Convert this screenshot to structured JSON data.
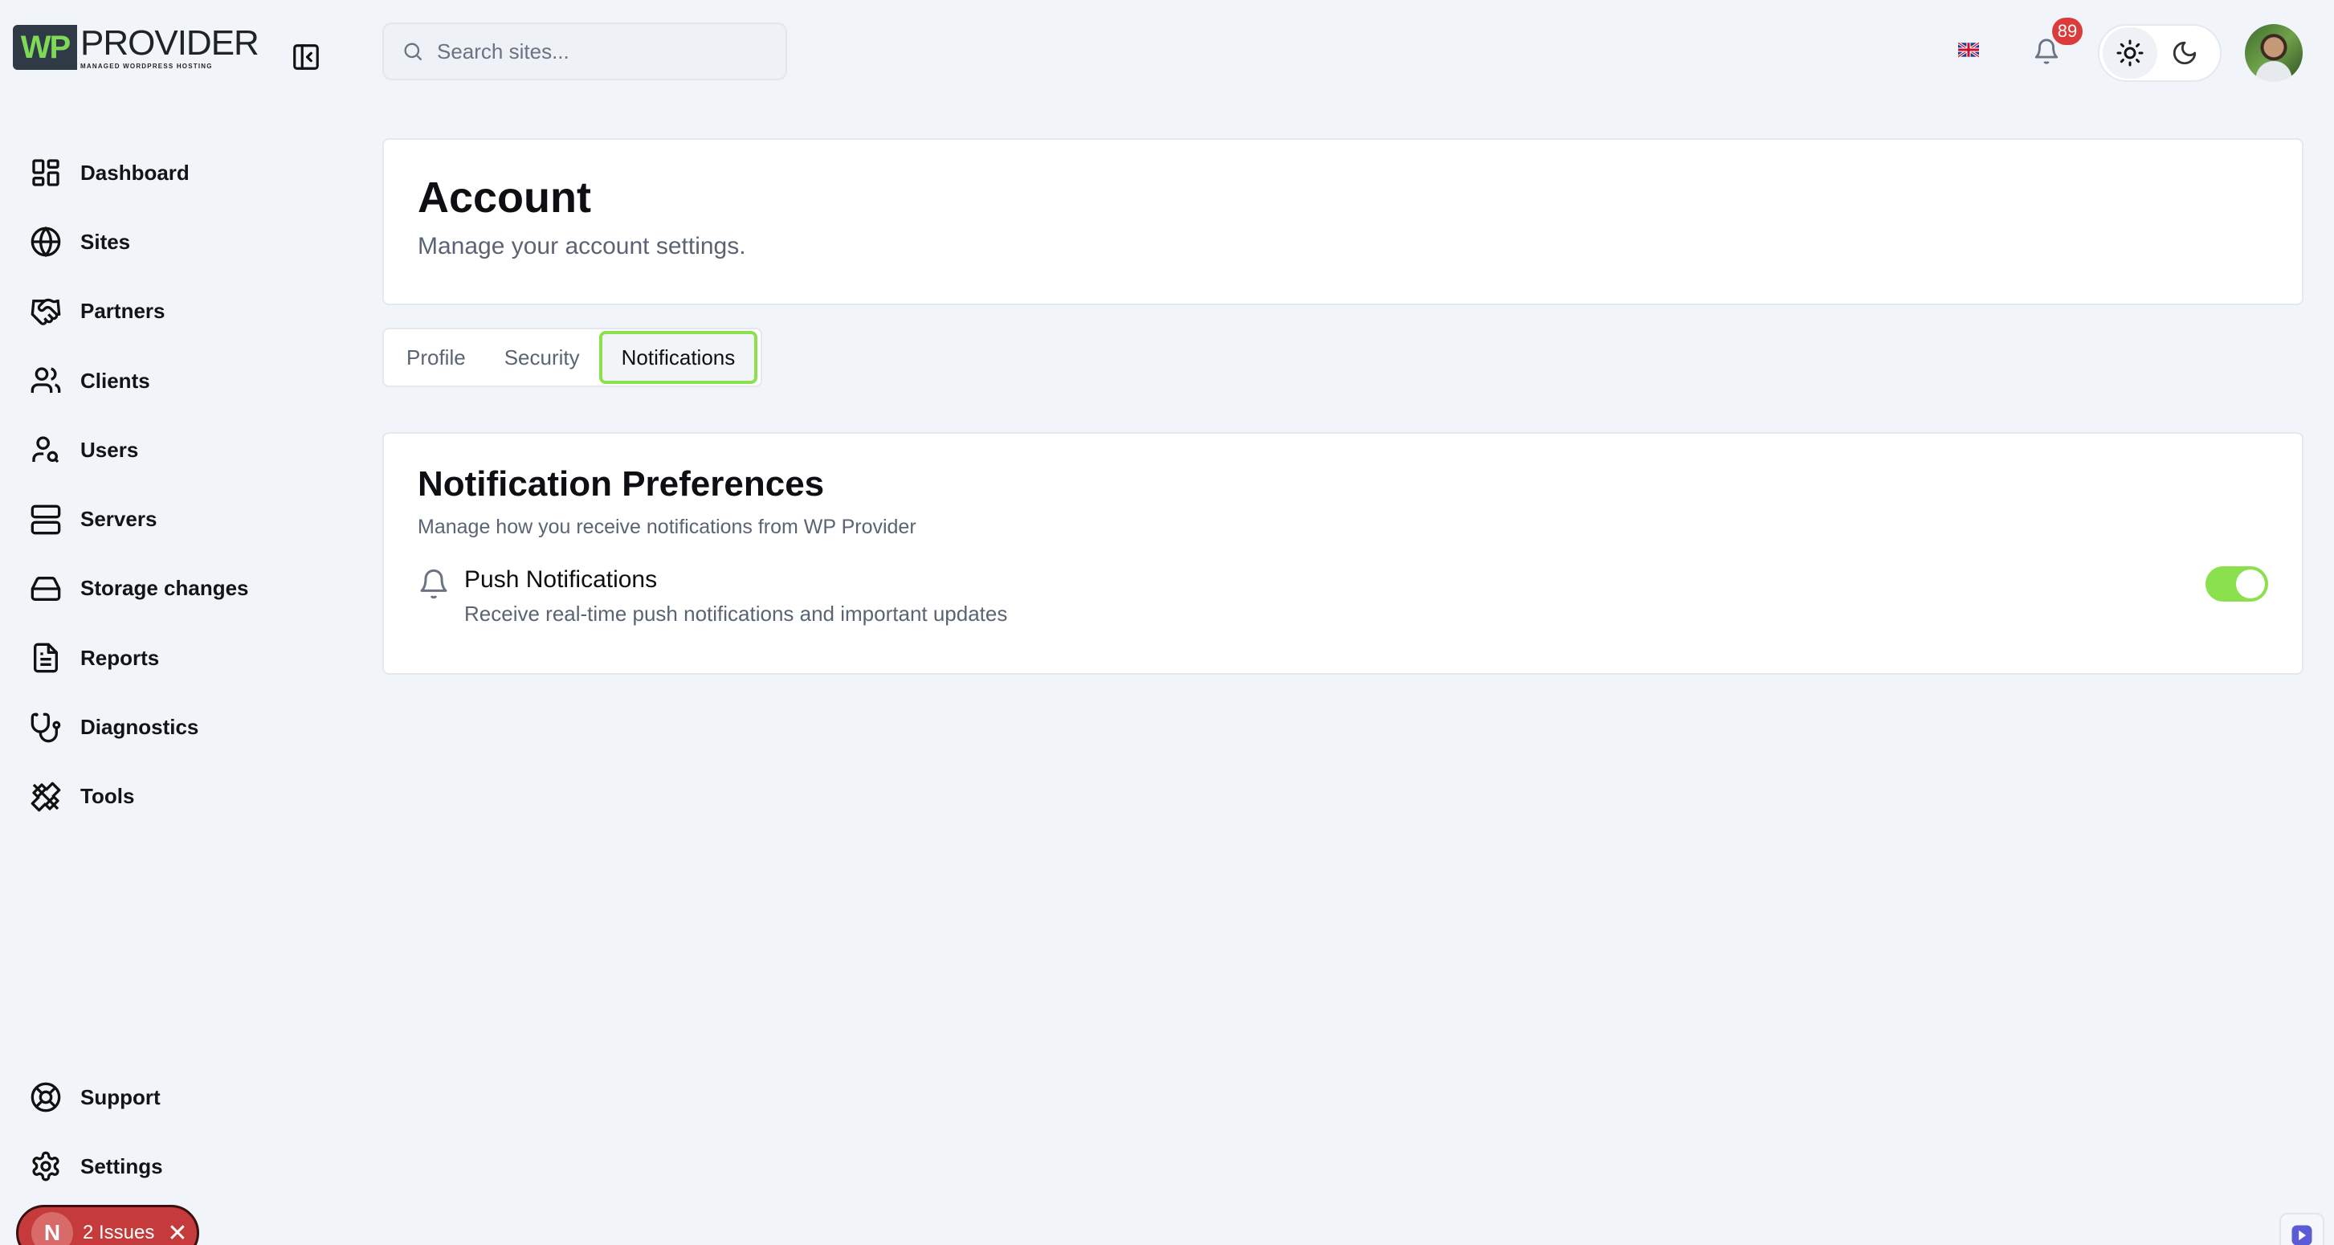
{
  "brand": {
    "logo_mark": "WP",
    "logo_name": "PROVIDER",
    "logo_tagline": "MANAGED WORDPRESS HOSTING"
  },
  "sidebar": {
    "items": [
      {
        "label": "Dashboard",
        "icon": "dashboard-icon"
      },
      {
        "label": "Sites",
        "icon": "globe-icon"
      },
      {
        "label": "Partners",
        "icon": "handshake-icon"
      },
      {
        "label": "Clients",
        "icon": "users-icon"
      },
      {
        "label": "Users",
        "icon": "user-search-icon"
      },
      {
        "label": "Servers",
        "icon": "server-icon"
      },
      {
        "label": "Storage changes",
        "icon": "hard-drive-icon"
      },
      {
        "label": "Reports",
        "icon": "file-text-icon"
      },
      {
        "label": "Diagnostics",
        "icon": "stethoscope-icon"
      },
      {
        "label": "Tools",
        "icon": "tools-icon"
      }
    ],
    "bottom_items": [
      {
        "label": "Support",
        "icon": "life-buoy-icon"
      },
      {
        "label": "Settings",
        "icon": "gear-icon"
      }
    ]
  },
  "issues_badge": {
    "letter": "N",
    "label": "2 Issues"
  },
  "header": {
    "search_placeholder": "Search sites...",
    "notification_count": "89"
  },
  "account": {
    "title": "Account",
    "subtitle": "Manage your account settings."
  },
  "tabs": [
    {
      "label": "Profile",
      "active": false
    },
    {
      "label": "Security",
      "active": false
    },
    {
      "label": "Notifications",
      "active": true
    }
  ],
  "preferences": {
    "title": "Notification Preferences",
    "subtitle": "Manage how you receive notifications from WP Provider",
    "push": {
      "label": "Push Notifications",
      "description": "Receive real-time push notifications and important updates",
      "enabled": true
    }
  },
  "colors": {
    "accent": "#8be04e",
    "badge": "#dc3b3b",
    "background": "#f1f4f9"
  }
}
